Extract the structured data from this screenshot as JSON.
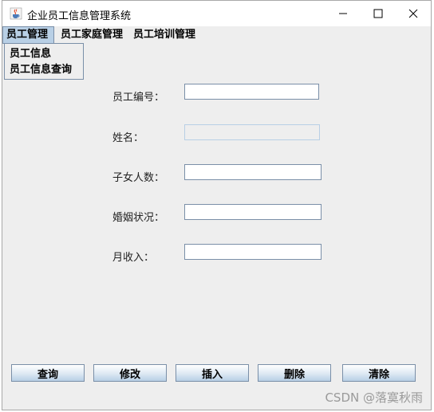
{
  "window": {
    "title": "企业员工信息管理系统"
  },
  "menubar": {
    "menus": [
      "员工管理",
      "员工家庭管理",
      "员工培训管理"
    ],
    "dropdown": [
      "员工信息",
      "员工信息查询"
    ]
  },
  "form": {
    "employee_id_label": "员工编号：",
    "name_label": "姓名：",
    "children_label": "子女人数：",
    "marital_label": "婚姻状况：",
    "income_label": "月收入："
  },
  "buttons": {
    "query": "查询",
    "modify": "修改",
    "insert": "插入",
    "delete": "删除",
    "clear": "清除"
  },
  "watermark": "CSDN @落寞秋雨",
  "icons": {
    "app": "java-coffee-icon",
    "minimize": "minimize-icon",
    "maximize": "maximize-icon",
    "close": "close-icon"
  }
}
